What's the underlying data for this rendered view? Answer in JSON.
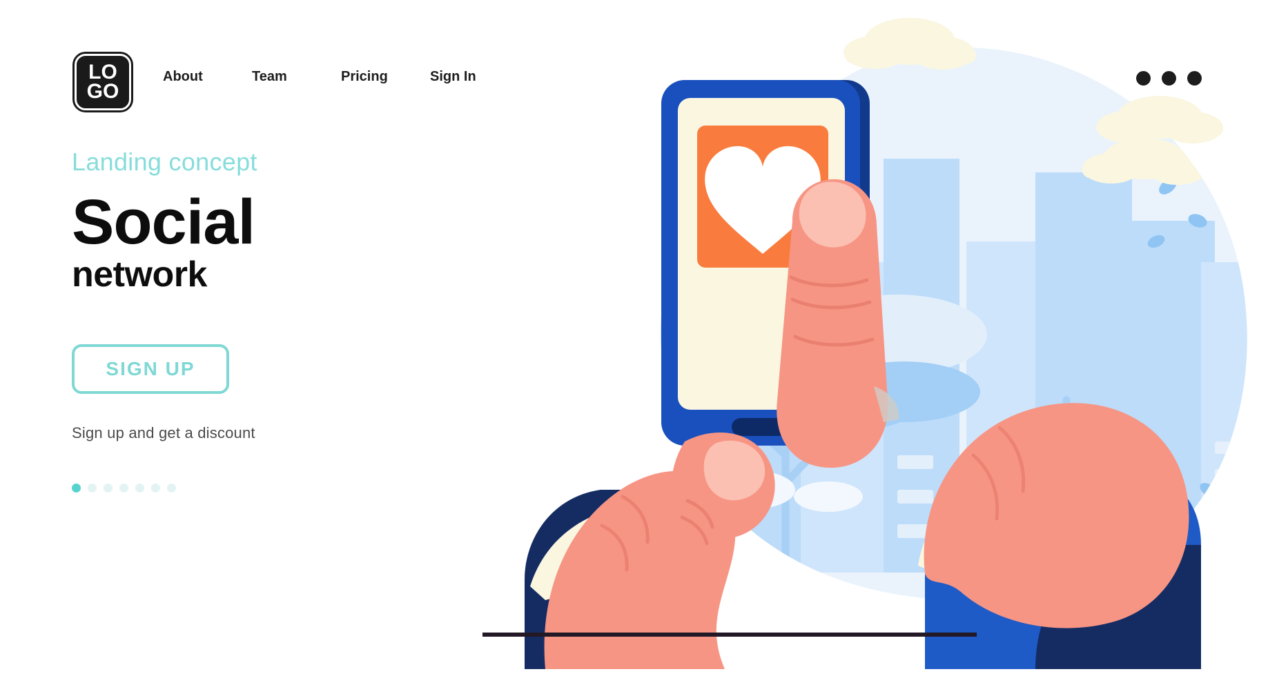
{
  "header": {
    "logo": {
      "line1": "LO",
      "line2": "GO",
      "name": "logo"
    },
    "nav": [
      {
        "label": "About"
      },
      {
        "label": "Team"
      },
      {
        "label": "Pricing"
      },
      {
        "label": "Sign In"
      }
    ],
    "menu_icon": "more-horizontal-icon"
  },
  "hero": {
    "eyebrow": "Landing concept",
    "title_main": "Social",
    "title_sub": "network",
    "cta_label": "SIGN UP",
    "note": "Sign up and get a discount",
    "carousel": {
      "total": 7,
      "active_index": 0
    }
  },
  "illustration": {
    "name": "social-network-hero-illustration",
    "elements": [
      "background-blob",
      "clouds",
      "city-buildings",
      "trees",
      "falling-leaves",
      "smartphone",
      "heart-icon-card",
      "pointing-hand",
      "holding-hand",
      "ground-line"
    ]
  },
  "colors": {
    "accent_teal": "#7FD8D4",
    "accent_teal_active": "#58D2CE",
    "text_dark": "#0d0d0d",
    "text_gray": "#4a4a4a",
    "phone_blue": "#1950BE",
    "phone_blue_dark": "#123A8C",
    "screen_cream": "#FAF6E0",
    "card_orange": "#F97B3D",
    "heart_white": "#FFFFFF",
    "skin": "#F79584",
    "sleeve_navy": "#152C63",
    "sleeve_blue": "#1E5BC6",
    "cuff_cream": "#FAF6E0",
    "blob_light": "#EAF3FC",
    "blob_blue": "#A8D0F5",
    "blob_blue_mid": "#C9E1F8",
    "cloud_cream": "#FAF6E0",
    "ground_line": "#221826"
  }
}
